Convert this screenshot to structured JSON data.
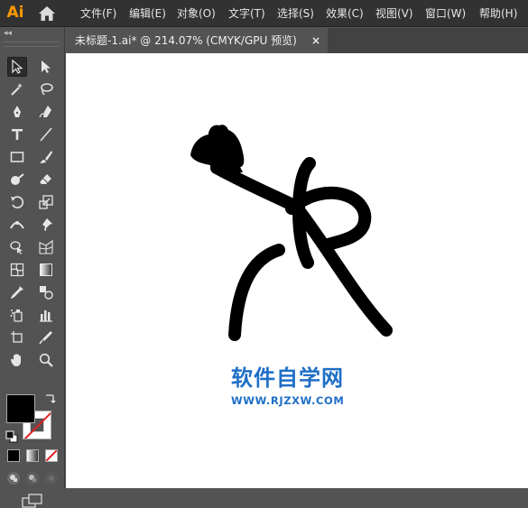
{
  "app": {
    "logo": "Ai",
    "icons": [
      "home-icon"
    ]
  },
  "menu": {
    "items": [
      {
        "label": "文件(F)"
      },
      {
        "label": "编辑(E)"
      },
      {
        "label": "对象(O)"
      },
      {
        "label": "文字(T)"
      },
      {
        "label": "选择(S)"
      },
      {
        "label": "效果(C)"
      },
      {
        "label": "视图(V)"
      },
      {
        "label": "窗口(W)"
      },
      {
        "label": "帮助(H)"
      }
    ]
  },
  "tool_panel": {
    "collapse_glyph": "◂◂",
    "tools": [
      {
        "icon": "selection-tool-icon",
        "active": true
      },
      {
        "icon": "direct-selection-tool-icon"
      },
      {
        "icon": "magic-wand-tool-icon"
      },
      {
        "icon": "lasso-tool-icon"
      },
      {
        "icon": "pen-tool-icon"
      },
      {
        "icon": "curvature-tool-icon"
      },
      {
        "icon": "type-tool-icon",
        "glyph": "T"
      },
      {
        "icon": "line-segment-tool-icon"
      },
      {
        "icon": "rectangle-tool-icon"
      },
      {
        "icon": "paintbrush-tool-icon"
      },
      {
        "icon": "shaper-tool-icon"
      },
      {
        "icon": "eraser-tool-icon"
      },
      {
        "icon": "rotate-tool-icon"
      },
      {
        "icon": "scale-tool-icon"
      },
      {
        "icon": "width-tool-icon"
      },
      {
        "icon": "puppet-warp-tool-icon"
      },
      {
        "icon": "shape-builder-tool-icon"
      },
      {
        "icon": "perspective-grid-tool-icon"
      },
      {
        "icon": "mesh-tool-icon"
      },
      {
        "icon": "gradient-tool-icon"
      },
      {
        "icon": "eyedropper-tool-icon"
      },
      {
        "icon": "blend-tool-icon"
      },
      {
        "icon": "symbol-sprayer-tool-icon"
      },
      {
        "icon": "column-graph-tool-icon"
      },
      {
        "icon": "artboard-tool-icon"
      },
      {
        "icon": "slice-tool-icon"
      },
      {
        "icon": "hand-tool-icon"
      },
      {
        "icon": "zoom-tool-icon"
      }
    ],
    "fill_color": "#000000",
    "stroke_color": "none"
  },
  "document": {
    "tab_title": "未标题-1.ai* @ 214.07% (CMYK/GPU 预览)",
    "close_glyph": "×"
  },
  "canvas": {
    "watermark_cn": "软件自学网",
    "watermark_url": "WWW.RJZXW.COM"
  },
  "colors": {
    "accent": "#ff9a00",
    "menubar": "#323232",
    "panel": "#535353",
    "canvas": "#ffffff",
    "watermark": "#1f6fc7"
  }
}
